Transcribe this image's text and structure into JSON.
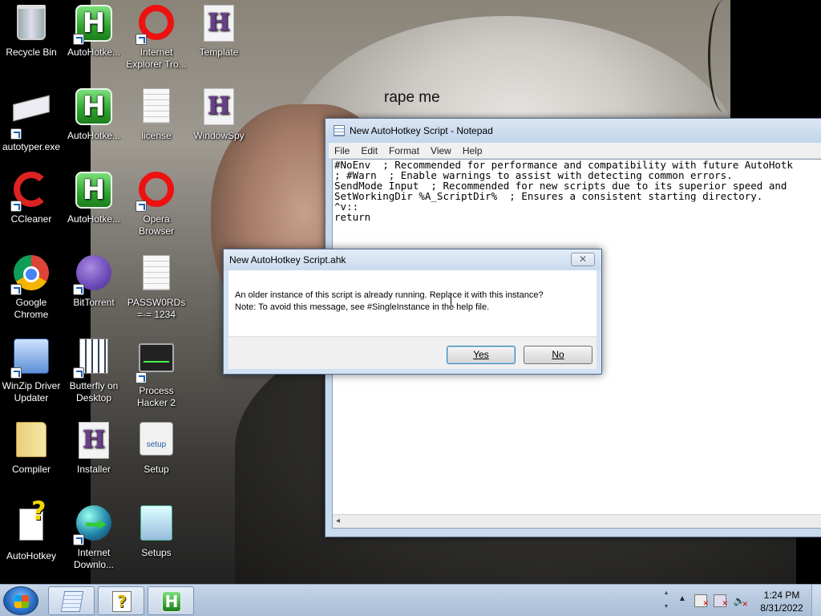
{
  "wallpaper": {
    "caption": "rape me"
  },
  "desktop_icons": [
    {
      "label": "Recycle Bin",
      "icon": "recycle-bin-icon"
    },
    {
      "label": "AutoHotke...",
      "icon": "autohotkey-icon"
    },
    {
      "label": "Internet Explorer Tro...",
      "icon": "opera-icon"
    },
    {
      "label": "Template",
      "icon": "ahk-script-icon"
    },
    {
      "label": "autotyper.exe",
      "icon": "keyboard-icon"
    },
    {
      "label": "AutoHotke...",
      "icon": "autohotkey-icon"
    },
    {
      "label": "license",
      "icon": "text-document-icon"
    },
    {
      "label": "WindowSpy",
      "icon": "ahk-script-icon"
    },
    {
      "label": "CCleaner",
      "icon": "ccleaner-icon"
    },
    {
      "label": "AutoHotke...",
      "icon": "autohotkey-icon"
    },
    {
      "label": "Opera Browser",
      "icon": "opera-icon"
    },
    {
      "label": "Google Chrome",
      "icon": "chrome-icon"
    },
    {
      "label": "BitTorrent",
      "icon": "bittorrent-icon"
    },
    {
      "label": "PASSW0RDs =-= 1234",
      "icon": "text-document-icon"
    },
    {
      "label": "WinZip Driver Updater",
      "icon": "winzip-icon"
    },
    {
      "label": "Butterfly on Desktop",
      "icon": "butterfly-icon"
    },
    {
      "label": "Process Hacker 2",
      "icon": "process-hacker-icon"
    },
    {
      "label": "Compiler",
      "icon": "folder-icon"
    },
    {
      "label": "Installer",
      "icon": "ahk-script-icon"
    },
    {
      "label": "Setup",
      "icon": "setup-icon"
    },
    {
      "label": "AutoHotkey",
      "icon": "autohotkey-help-icon"
    },
    {
      "label": "Internet Downlo...",
      "icon": "download-manager-icon"
    },
    {
      "label": "Setups",
      "icon": "setups-icon"
    }
  ],
  "notepad": {
    "title": "New AutoHotkey Script - Notepad",
    "menu": [
      "File",
      "Edit",
      "Format",
      "View",
      "Help"
    ],
    "content": "#NoEnv  ; Recommended for performance and compatibility with future AutoHotk\n; #Warn  ; Enable warnings to assist with detecting common errors.\nSendMode Input  ; Recommended for new scripts due to its superior speed and\nSetWorkingDir %A_ScriptDir%  ; Ensures a consistent starting directory.\n^v::\nreturn"
  },
  "dialog": {
    "title": "New AutoHotkey Script.ahk",
    "close_glyph": "✕",
    "line1": "An older instance of this script is already running.  Replace it with this instance?",
    "line2": "Note: To avoid this message, see #SingleInstance in the help file.",
    "yes_label": "Yes",
    "no_label": "No",
    "default_button": "Yes"
  },
  "taskbar": {
    "pinned": [
      {
        "name": "notepad",
        "icon": "notepad-icon",
        "glyph": ""
      },
      {
        "name": "autohotkey-help",
        "icon": "autohotkey-help-icon",
        "glyph": "?"
      },
      {
        "name": "autohotkey",
        "icon": "autohotkey-icon",
        "glyph": "H"
      }
    ],
    "tray_arrow": "▲",
    "clock_time": "1:24 PM",
    "clock_date": "8/31/2022"
  }
}
